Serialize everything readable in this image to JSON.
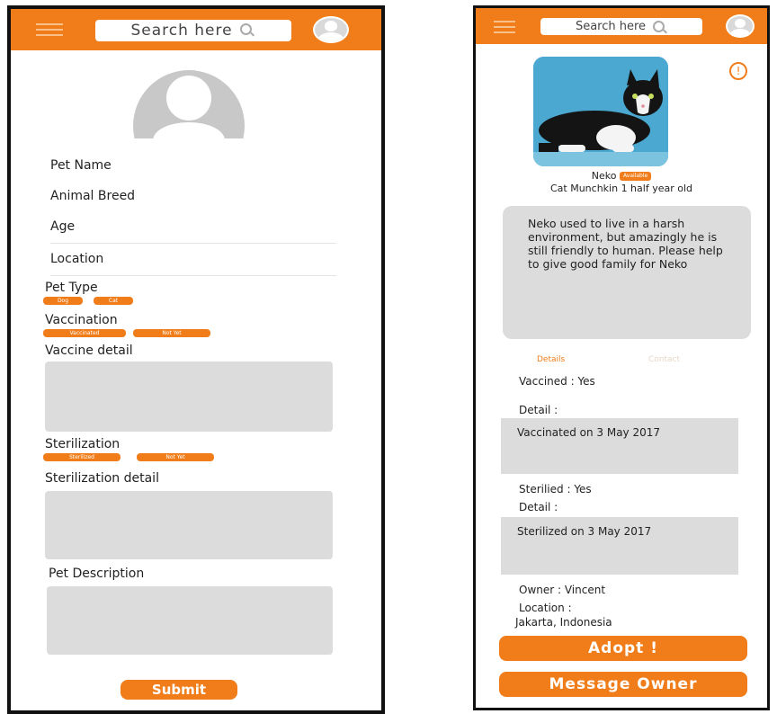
{
  "colors": {
    "accent": "#f07d1a",
    "field_bg": "#dcdcdc",
    "avatar_grey": "#c8c8c8"
  },
  "form_screen": {
    "header": {
      "search_placeholder": "Search here"
    },
    "fields": [
      "Pet Name",
      "Animal Breed",
      "Age",
      "Location"
    ],
    "pet_type": {
      "label": "Pet Type",
      "options": [
        "Dog",
        "Cat"
      ]
    },
    "vaccination": {
      "label": "Vaccination",
      "options": [
        "Vaccinated",
        "Not Yet"
      ]
    },
    "vaccine_detail_label": "Vaccine detail",
    "sterilization": {
      "label": "Sterilization",
      "options": [
        "Sterilized",
        "Not Yet"
      ]
    },
    "sterilization_detail_label": "Sterilization detail",
    "pet_description_label": "Pet Description",
    "submit_label": "Submit"
  },
  "detail_screen": {
    "header": {
      "search_placeholder": "Search here"
    },
    "pet_name": "Neko",
    "status_badge": "Available",
    "pet_summary": "Cat Munchkin 1 half year old",
    "description": "Neko used to live in a harsh environment, but amazingly he is still friendly to human. Please help to give good family for Neko",
    "tabs": [
      "Details",
      "Contact"
    ],
    "vaccined": "Vaccined : Yes",
    "vaccine_detail_label": "Detail :",
    "vaccine_detail": "Vaccinated on 3 May 2017",
    "sterilized": "Sterilied : Yes",
    "sterile_detail_label": "Detail :",
    "sterile_detail": "Sterilized on 3 May 2017",
    "owner": "Owner : Vincent",
    "location_label": "Location :",
    "location_value": "Jakarta, Indonesia",
    "adopt_label": "Adopt !",
    "message_label": "Message Owner"
  }
}
